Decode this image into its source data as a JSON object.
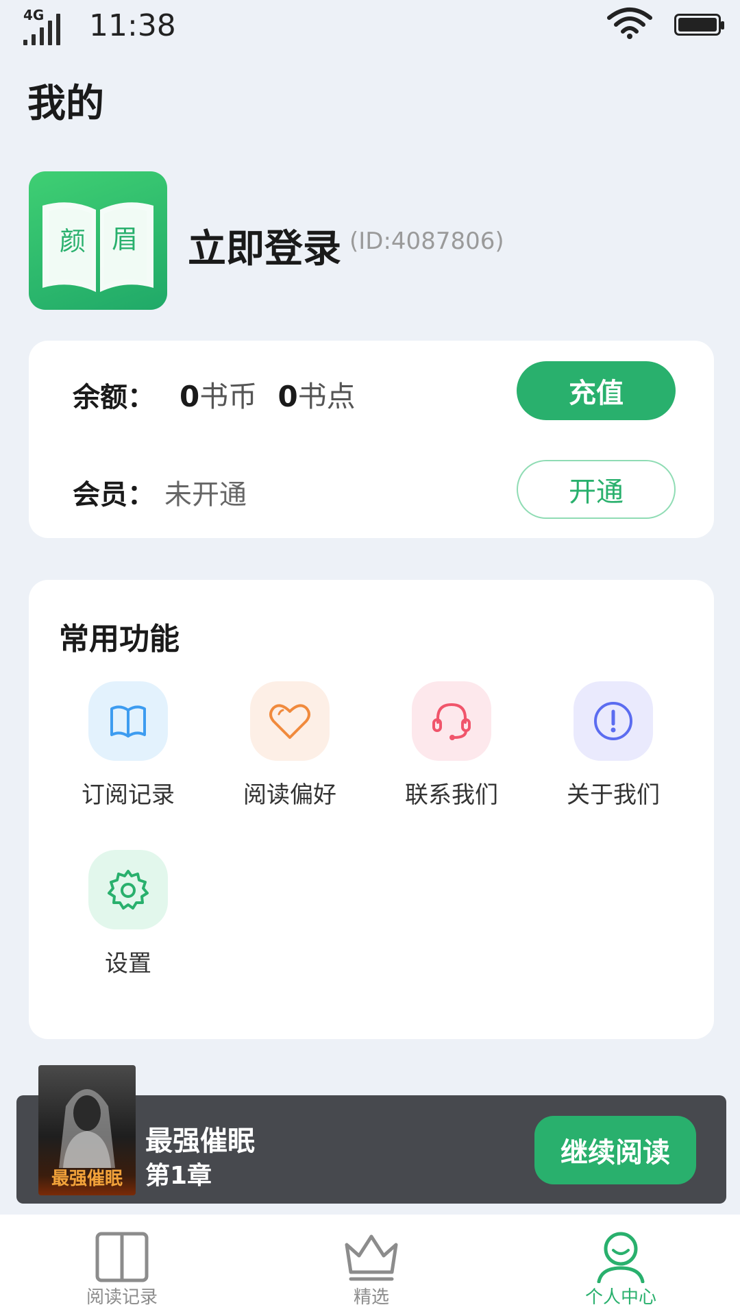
{
  "status_bar": {
    "network": "4G",
    "time": "11:38"
  },
  "header": {
    "title": "我的"
  },
  "profile": {
    "logo_chars": [
      "颜",
      "眉"
    ],
    "login_label": "立即登录",
    "user_id": "(ID:4087806)"
  },
  "balance": {
    "label": "余额：",
    "coins_value": "0",
    "coins_unit": "书币",
    "points_value": "0",
    "points_unit": "书点",
    "recharge_label": "充值",
    "member_label": "会员：",
    "member_status": "未开通",
    "open_label": "开通"
  },
  "functions": {
    "title": "常用功能",
    "items": [
      {
        "label": "订阅记录",
        "icon": "book-icon",
        "color": "#3d9cf0",
        "bg": "#e3f2fd"
      },
      {
        "label": "阅读偏好",
        "icon": "heart-icon",
        "color": "#f08a3d",
        "bg": "#fdefe6"
      },
      {
        "label": "联系我们",
        "icon": "headset-icon",
        "color": "#f0556b",
        "bg": "#fde8ec"
      },
      {
        "label": "关于我们",
        "icon": "info-icon",
        "color": "#5b6cf0",
        "bg": "#eaeafd"
      },
      {
        "label": "设置",
        "icon": "gear-icon",
        "color": "#29b06d",
        "bg": "#e2f7ec"
      }
    ]
  },
  "continue_reading": {
    "cover_text": "最强催眠",
    "book_title": "最强催眠",
    "chapter": "第1章",
    "button_label": "继续阅读"
  },
  "tab_bar": {
    "tabs": [
      {
        "label": "阅读记录",
        "icon": "open-book-icon",
        "active": false
      },
      {
        "label": "精选",
        "icon": "crown-icon",
        "active": false
      },
      {
        "label": "个人中心",
        "icon": "user-icon",
        "active": true
      }
    ]
  },
  "colors": {
    "accent": "#29b06d",
    "background": "#edf1f7"
  }
}
